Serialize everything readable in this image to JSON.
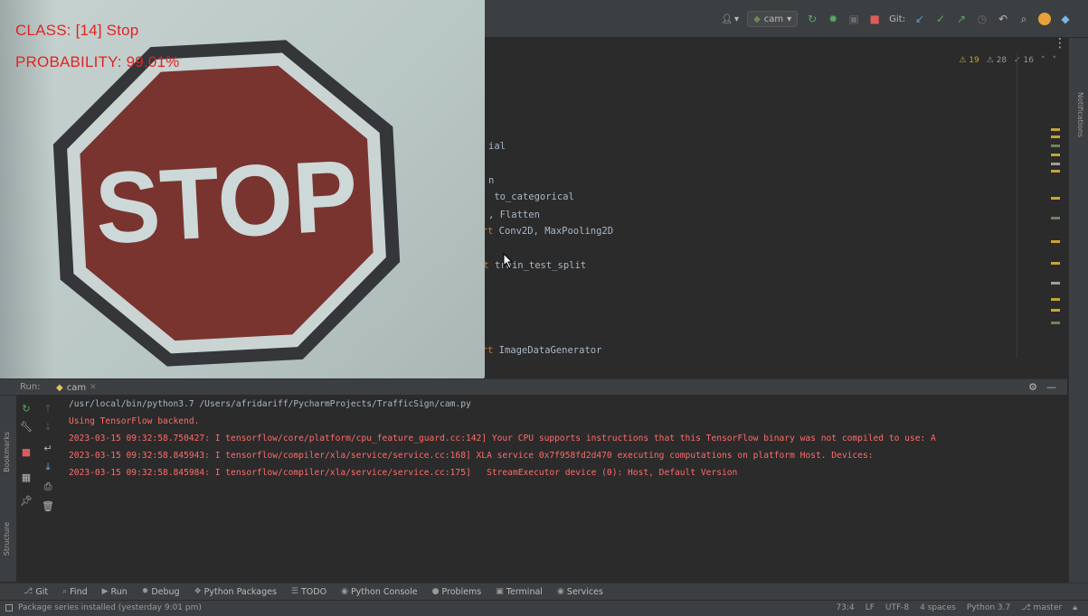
{
  "toolbar": {
    "run_config": "cam",
    "git_label": "Git:"
  },
  "editor": {
    "inspections": {
      "warnings": "19",
      "weak_warnings": "28",
      "typos": "16"
    },
    "code_lines": [
      {
        "text": "ial",
        "kw": ""
      },
      {
        "text": "n",
        "kw": ""
      },
      {
        "text": " to_categorical",
        "kw": ""
      },
      {
        "text": ", Flatten",
        "kw": ""
      },
      {
        "text": " Conv2D, MaxPooling2D",
        "kw": "port"
      },
      {
        "text": " train_test_split",
        "kw": "rt"
      },
      {
        "text": " ImageDataGenerator",
        "kw": "port"
      },
      {
        "text": "§§§§§§§§§§§§§§§§§§§§§§§§§",
        "kw": ""
      }
    ]
  },
  "notifications": {
    "label": "Notifications"
  },
  "camera": {
    "class_text": "CLASS:  [14] Stop",
    "probability_text": "PROBABILITY: 99.01%",
    "sign_text": "STOP"
  },
  "run": {
    "label": "Run:",
    "tab": "cam",
    "console": [
      {
        "type": "cmd",
        "text": "/usr/local/bin/python3.7 /Users/afridariff/PycharmProjects/TrafficSign/cam.py"
      },
      {
        "type": "err",
        "text": "Using TensorFlow backend."
      },
      {
        "type": "err",
        "text": "2023-03-15 09:32:58.750427: I tensorflow/core/platform/cpu_feature_guard.cc:142] Your CPU supports instructions that this TensorFlow binary was not compiled to use: A"
      },
      {
        "type": "err",
        "text": "2023-03-15 09:32:58.845943: I tensorflow/compiler/xla/service/service.cc:168] XLA service 0x7f958fd2d470 executing computations on platform Host. Devices:"
      },
      {
        "type": "err",
        "text": "2023-03-15 09:32:58.845984: I tensorflow/compiler/xla/service/service.cc:175]   StreamExecutor device (0): Host, Default Version"
      }
    ]
  },
  "side_labels": {
    "bookmarks": "Bookmarks",
    "structure": "Structure"
  },
  "bottom_tools": [
    {
      "icon": "git-icon",
      "glyph": "⎇",
      "label": "Git"
    },
    {
      "icon": "find-icon",
      "glyph": "⌕",
      "label": "Find"
    },
    {
      "icon": "run-icon",
      "glyph": "▶",
      "label": "Run"
    },
    {
      "icon": "debug-icon",
      "glyph": "✹",
      "label": "Debug"
    },
    {
      "icon": "python-packages-icon",
      "glyph": "❖",
      "label": "Python Packages"
    },
    {
      "icon": "todo-icon",
      "glyph": "☰",
      "label": "TODO"
    },
    {
      "icon": "python-console-icon",
      "glyph": "◉",
      "label": "Python Console"
    },
    {
      "icon": "problems-icon",
      "glyph": "●",
      "label": "Problems"
    },
    {
      "icon": "terminal-icon",
      "glyph": "▣",
      "label": "Terminal"
    },
    {
      "icon": "services-icon",
      "glyph": "◉",
      "label": "Services"
    }
  ],
  "status": {
    "message": "Package series installed (yesterday 9:01 pm)",
    "position": "73:4",
    "line_sep": "LF",
    "encoding": "UTF-8",
    "indent": "4 spaces",
    "interpreter": "Python 3.7",
    "branch": "master"
  }
}
